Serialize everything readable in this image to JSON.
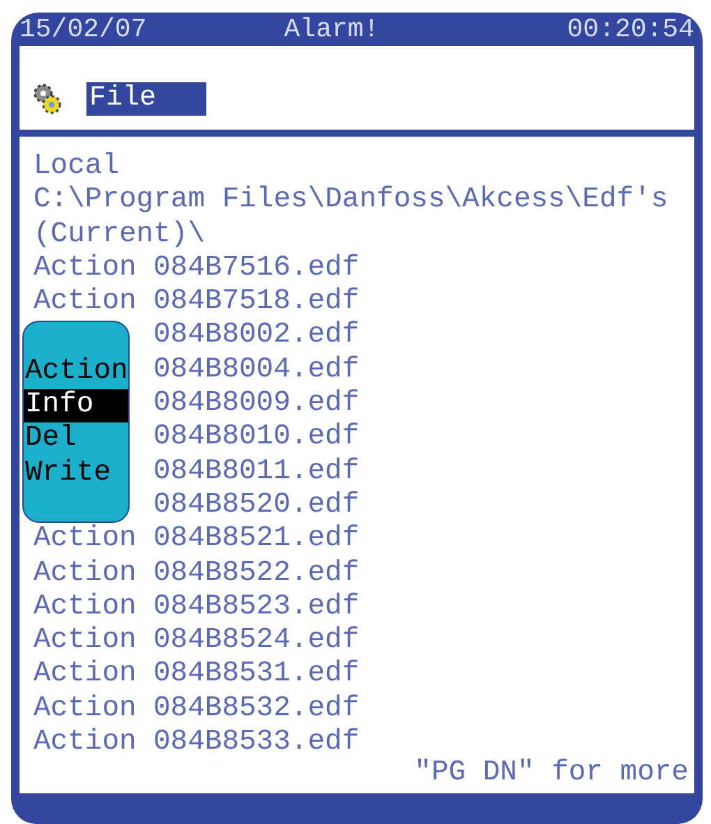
{
  "status_bar": {
    "date": "15/02/07",
    "title": "Alarm!",
    "time": "00:20:54"
  },
  "header": {
    "label": "File"
  },
  "location": {
    "drive": "Local",
    "path": "C:\\Program Files\\Danfoss\\Akcess\\Edf's",
    "folder": "(Current)\\"
  },
  "files": [
    {
      "action": "Action",
      "name": "084B7516.edf"
    },
    {
      "action": "Action",
      "name": "084B7518.edf"
    },
    {
      "name": "084B8002.edf"
    },
    {
      "name": "084B8004.edf"
    },
    {
      "name": "084B8009.edf"
    },
    {
      "name": "084B8010.edf"
    },
    {
      "name": "084B8011.edf"
    },
    {
      "name": "084B8520.edf"
    },
    {
      "action": "Action",
      "name": "084B8521.edf"
    },
    {
      "action": "Action",
      "name": "084B8522.edf"
    },
    {
      "action": "Action",
      "name": "084B8523.edf"
    },
    {
      "action": "Action",
      "name": "084B8524.edf"
    },
    {
      "action": "Action",
      "name": "084B8531.edf"
    },
    {
      "action": "Action",
      "name": "084B8532.edf"
    },
    {
      "action": "Action",
      "name": "084B8533.edf"
    }
  ],
  "popup_menu": [
    {
      "label": "Action",
      "selected": false
    },
    {
      "label": "Info",
      "selected": true
    },
    {
      "label": "Del",
      "selected": false
    },
    {
      "label": "Write",
      "selected": false
    }
  ],
  "footer_hint": "\"PG DN\" for more"
}
